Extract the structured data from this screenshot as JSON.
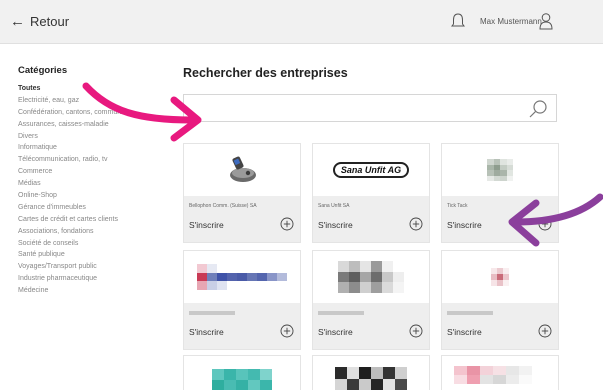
{
  "header": {
    "back_label": "Retour",
    "username": "Max Mustermann"
  },
  "sidebar": {
    "heading": "Catégories",
    "items": [
      {
        "label": "Toutes"
      },
      {
        "label": "Electricité, eau, gaz"
      },
      {
        "label": "Confédération, cantons, communes"
      },
      {
        "label": "Assurances, caisses-maladie"
      },
      {
        "label": "Divers"
      },
      {
        "label": "Informatique"
      },
      {
        "label": "Télécommunication, radio, tv"
      },
      {
        "label": "Commerce"
      },
      {
        "label": "Médias"
      },
      {
        "label": "Online-Shop"
      },
      {
        "label": "Gérance d'immeubles"
      },
      {
        "label": "Cartes de crédit et cartes clients"
      },
      {
        "label": "Associations, fondations"
      },
      {
        "label": "Société de conseils"
      },
      {
        "label": "Santé publique"
      },
      {
        "label": "Voyages/Transport public"
      },
      {
        "label": "Industrie pharmaceutique"
      },
      {
        "label": "Médecine"
      }
    ]
  },
  "main": {
    "title": "Rechercher des entreprises",
    "search": {
      "value": "",
      "placeholder": ""
    },
    "cards": [
      {
        "name": "Bellophon Comm. (Suisse) SA",
        "subscribe": "S'inscrire",
        "logo": "phone-logo"
      },
      {
        "name": "Sana Unfit SA",
        "subscribe": "S'inscrire",
        "logo": "Sana Unfit AG"
      },
      {
        "name": "Tick Tack",
        "subscribe": "S'inscrire",
        "logo": "tick-tack-logo"
      },
      {
        "name": "",
        "subscribe": "S'inscrire",
        "logo": "pixelated-logo"
      },
      {
        "name": "",
        "subscribe": "S'inscrire",
        "logo": "pixelated-logo"
      },
      {
        "name": "",
        "subscribe": "S'inscrire",
        "logo": "pixelated-logo"
      },
      {
        "name": "",
        "subscribe": "",
        "logo": "pixelated-logo"
      },
      {
        "name": "",
        "subscribe": "",
        "logo": "pixelated-logo"
      },
      {
        "name": "",
        "subscribe": "",
        "logo": "pixelated-logo"
      }
    ]
  },
  "colors": {
    "topbar_bg": "#f1f1f1",
    "card_info_bg": "#eeeeee",
    "annotation_pink": "#e8197f",
    "annotation_purple": "#8b3f9c"
  },
  "icons": [
    "back-arrow-icon",
    "bell-icon",
    "user-icon",
    "search-icon",
    "plus-circle-icon"
  ]
}
